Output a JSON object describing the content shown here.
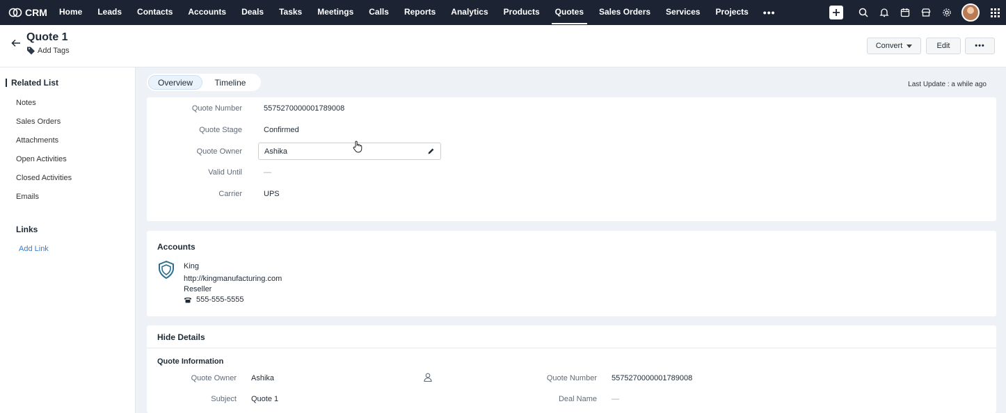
{
  "nav": {
    "brand": "CRM",
    "items": [
      "Home",
      "Leads",
      "Contacts",
      "Accounts",
      "Deals",
      "Tasks",
      "Meetings",
      "Calls",
      "Reports",
      "Analytics",
      "Products",
      "Quotes",
      "Sales Orders",
      "Services",
      "Projects"
    ],
    "active": "Quotes",
    "more": "•••"
  },
  "header": {
    "title": "Quote 1",
    "add_tags": "Add Tags",
    "convert": "Convert",
    "edit": "Edit",
    "more": "•••"
  },
  "sidebar": {
    "related_list": "Related List",
    "items": [
      "Notes",
      "Sales Orders",
      "Attachments",
      "Open Activities",
      "Closed Activities",
      "Emails"
    ],
    "links_title": "Links",
    "add_link": "Add Link"
  },
  "tabs": {
    "overview": "Overview",
    "timeline": "Timeline",
    "last_update": "Last Update : a while ago"
  },
  "summary": {
    "fields": [
      {
        "label": "Quote Number",
        "value": "5575270000001789008"
      },
      {
        "label": "Quote Stage",
        "value": "Confirmed"
      },
      {
        "label": "Quote Owner",
        "value": "Ashika"
      },
      {
        "label": "Valid Until",
        "value": "—"
      },
      {
        "label": "Carrier",
        "value": "UPS"
      }
    ]
  },
  "accounts": {
    "title": "Accounts",
    "name": "King",
    "website": "http://kingmanufacturing.com",
    "type": "Reseller",
    "phone": "555-555-5555"
  },
  "details": {
    "toggle": "Hide Details",
    "section": "Quote Information",
    "owner_label": "Quote Owner",
    "owner_value": "Ashika",
    "subject_label": "Subject",
    "subject_value": "Quote 1",
    "number_label": "Quote Number",
    "number_value": "5575270000001789008",
    "deal_label": "Deal Name",
    "deal_value": "—"
  },
  "colors": {
    "topbar": "#1c2433",
    "link": "#2f7fd8",
    "accent_logo": "#2a6f8f"
  }
}
